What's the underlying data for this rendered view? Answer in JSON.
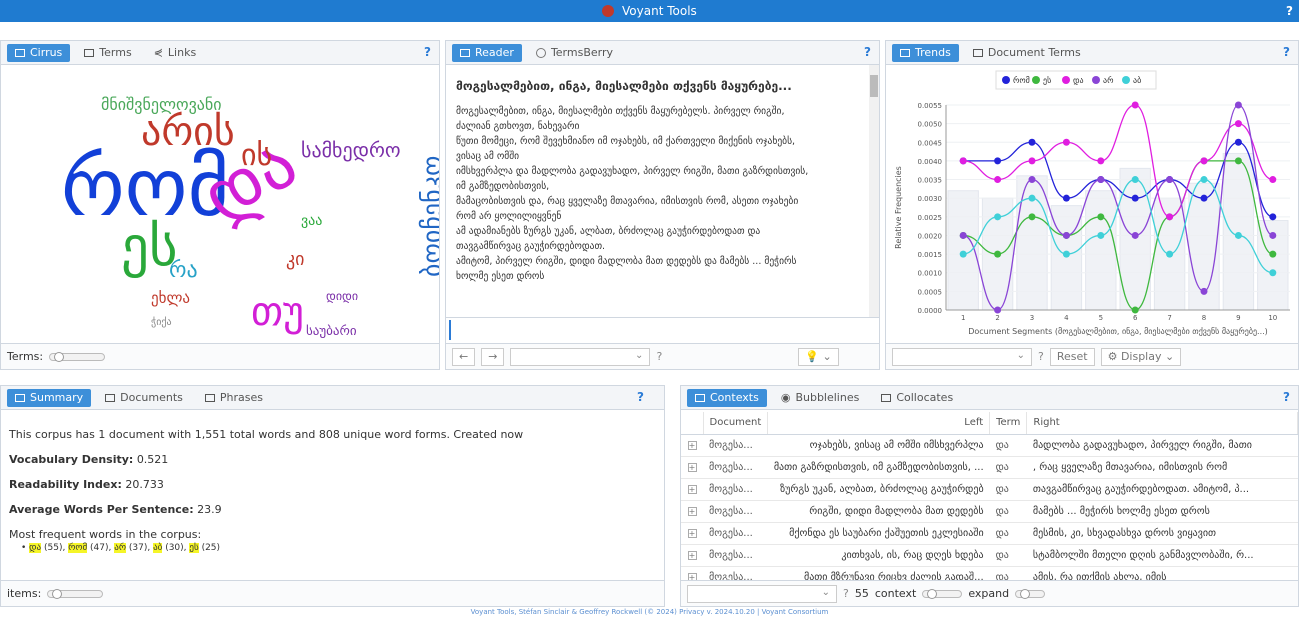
{
  "app": {
    "title": "Voyant Tools",
    "help": "?"
  },
  "cirrus_panel": {
    "tabs": [
      "Cirrus",
      "Terms",
      "Links"
    ],
    "help": "?",
    "terms_label": "Terms:",
    "words": [
      {
        "text": "რომ",
        "color": "#1240d8"
      },
      {
        "text": "და",
        "color": "#d21fd6"
      },
      {
        "text": "არის",
        "color": "#c0392b"
      },
      {
        "text": "ეს",
        "color": "#2aa83a"
      },
      {
        "text": "ის",
        "color": "#c0392b"
      },
      {
        "text": "სამხედრო",
        "color": "#7a2ea8"
      },
      {
        "text": "მნიშვნელოვანი",
        "color": "#4aa85a"
      },
      {
        "text": "რა",
        "color": "#27a2c7"
      },
      {
        "text": "ეხლა",
        "color": "#c0392b"
      },
      {
        "text": "ბოიჩენკო",
        "color": "#2066c4"
      },
      {
        "text": "დიდი",
        "color": "#7a2ea8"
      },
      {
        "text": "საუბარი",
        "color": "#7a2ea8"
      },
      {
        "text": "ჭიქა",
        "color": "#888"
      },
      {
        "text": "კი",
        "color": "#c0392b"
      },
      {
        "text": "ვაა",
        "color": "#2aa83a"
      },
      {
        "text": "თუ",
        "color": "#d21fd6"
      }
    ]
  },
  "reader_panel": {
    "tabs": [
      "Reader",
      "TermsBerry"
    ],
    "help": "?",
    "title": "მოგესალმებით, ინგა, მიესალმები თქვენს მაყურებე...",
    "lines": [
      "მოგესალმებით, ინგა, მიესალმები თქვენს მაყურებელს. პირველ რიგში,",
      "ძალიან გთხოვთ, ნახევარი",
      "წუთი მომეცი, რომ შევეხმიანო იმ ოჯახებს, იმ ქართველი მიქენის ოჯახებს,",
      "ვისაც ამ ომში",
      "იმსხვერპლა და მადლობა გადავუხადო, პირველ რიგში, მათი გაზრდისთვის,",
      "იმ გამზედობისთვის,",
      "მამაცობისთვის და, რაც ყველაზე მთავარია, იმისთვის რომ, ასეთი ოჯახები",
      "რომ არ ყოლილიყვნენ",
      "ამ ადამიანებს ზურგს უკან, ალბათ, ბრძოლაც გაუჭირდებოდათ და",
      "თავგამწირვაც გაუჭირდებოდათ.",
      "ამიტომ, პირველ რიგში, დიდი მადლობა მათ დედებს და მამებს ... მეჭირს",
      "ხოლმე ესეთ დროს"
    ]
  },
  "trends_panel": {
    "tabs": [
      "Trends",
      "Document Terms"
    ],
    "help": "?",
    "reset": "Reset",
    "display": "Display",
    "footer_help": "?"
  },
  "summary_panel": {
    "tabs": [
      "Summary",
      "Documents",
      "Phrases"
    ],
    "help": "?",
    "intro": "This corpus has 1 document with 1,551 total words and 808 unique word forms. Created now",
    "vocab_label": "Vocabulary Density:",
    "vocab_value": "0.521",
    "readability_label": "Readability Index:",
    "readability_value": "20.733",
    "avg_label": "Average Words Per Sentence:",
    "avg_value": "23.9",
    "freq_label": "Most frequent words in the corpus:",
    "freq_words": [
      {
        "word": "და",
        "count": "(55)"
      },
      {
        "word": "რომ",
        "count": "(47)"
      },
      {
        "word": "არ",
        "count": "(37)"
      },
      {
        "word": "აბ",
        "count": "(30)"
      },
      {
        "word": "ეს",
        "count": "(25)"
      }
    ],
    "items_label": "items:"
  },
  "contexts_panel": {
    "tabs": [
      "Contexts",
      "Bubblelines",
      "Collocates"
    ],
    "help": "?",
    "columns": [
      "Document",
      "Left",
      "Term",
      "Right"
    ],
    "rows": [
      [
        "მოგესა...",
        "ოჯახებს, ვისაც ამ ომში იმსხვერპლა",
        "და",
        "მადლობა გადავუხადო, პირველ რიგში, მათი"
      ],
      [
        "მოგესა...",
        "მათი გაზრდისთვის, იმ გამზედობისთვის, ...",
        "და",
        ", რაც ყველაზე მთავარია, იმისთვის რომ"
      ],
      [
        "მოგესა...",
        "ზურგს უკან, ალბათ, ბრძოლაც გაუჭირდებ",
        "და",
        "თავგამწირვაც გაუჭირდებოდათ. ამიტომ, პ..."
      ],
      [
        "მოგესა...",
        "რიგში, დიდი მადლობა მათ დედებს",
        "და",
        "მამებს ... მეჭირს ხოლმე ესეთ დროს"
      ],
      [
        "მოგესა...",
        "მქონდა ეს საუბარი ქაშუეთის ეკლესიაში",
        "და",
        "მესმის, კი, სხვადასხვა დროს ვიყავით"
      ],
      [
        "მოგესა...",
        "კითხვას, ის, რაც დღეს ხდება",
        "და",
        "სტამბოლში მთელი დღის განმავლობაში, რ..."
      ],
      [
        "მოგესა...",
        "მათი მზრუნავი რიცხვ ძალის გადაშ...",
        "და",
        "ამის, რა ითქმის ახლა, იმის"
      ]
    ],
    "footer_help": "?",
    "context_value": "55",
    "context_label": "context",
    "expand_label": "expand"
  },
  "footer": "Voyant Tools, Stéfan Sinclair & Geoffrey Rockwell (© 2024) Privacy v. 2024.10.20 | Voyant Consortium",
  "chart_data": {
    "type": "line",
    "ylabel": "Relative Frequencies",
    "xlabel": "Document Segments (მოგესალმებით, ინგა, მიესალმები თქვენს მაყურებე...)",
    "x": [
      1,
      2,
      3,
      4,
      5,
      6,
      7,
      8,
      9,
      10
    ],
    "ylim": [
      0,
      0.0055
    ],
    "yticks": [
      "0.0000",
      "0.0005",
      "0.0010",
      "0.0015",
      "0.0020",
      "0.0025",
      "0.0030",
      "0.0035",
      "0.0040",
      "0.0045",
      "0.0050",
      "0.0055"
    ],
    "series": [
      {
        "name": "რომ",
        "color": "#2323d9",
        "values": [
          0.004,
          0.004,
          0.0045,
          0.003,
          0.0035,
          0.003,
          0.0035,
          0.003,
          0.0045,
          0.0025
        ]
      },
      {
        "name": "ეს",
        "color": "#3fb83f",
        "values": [
          0.002,
          0.0015,
          0.0025,
          0.002,
          0.0025,
          0.0,
          0.0025,
          0.004,
          0.004,
          0.0015
        ]
      },
      {
        "name": "და",
        "color": "#e01ee0",
        "values": [
          0.004,
          0.0035,
          0.004,
          0.0045,
          0.004,
          0.0055,
          0.0025,
          0.004,
          0.005,
          0.0035
        ]
      },
      {
        "name": "არ",
        "color": "#8a45d6",
        "values": [
          0.002,
          0.0,
          0.0035,
          0.002,
          0.0035,
          0.002,
          0.0035,
          0.0005,
          0.0055,
          0.002
        ]
      },
      {
        "name": "აბ",
        "color": "#3fd0d8",
        "values": [
          0.0015,
          0.0025,
          0.003,
          0.0015,
          0.002,
          0.0035,
          0.0015,
          0.0035,
          0.002,
          0.001
        ]
      }
    ],
    "bars": [
      0.0032,
      0.003,
      0.0036,
      0.0028,
      0.0032,
      0.0038,
      0.003,
      0.0034,
      0.0042,
      0.0024
    ],
    "legend_position": "top"
  }
}
